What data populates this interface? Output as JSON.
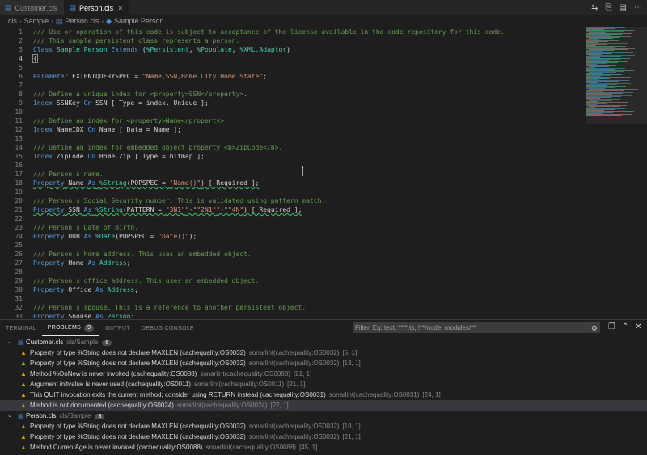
{
  "tabs": [
    {
      "label": "Customer.cls",
      "active": false
    },
    {
      "label": "Person.cls",
      "active": true
    }
  ],
  "tab_close": "×",
  "tab_actions": [
    "⇆",
    "⎘",
    "▤",
    "⋯"
  ],
  "breadcrumb": [
    "cls",
    "Sample",
    "Person.cls",
    "Sample.Person"
  ],
  "code_lines": [
    {
      "n": "1",
      "t": "/// Use or operation of this code is subject to acceptance of the license available in the code repository for this code."
    },
    {
      "n": "2",
      "t": "/// This sample persistent class represents a person."
    },
    {
      "n": "3",
      "t": "Class Sample.Person Extends (%Persistent, %Populate, %XML.Adaptor)"
    },
    {
      "n": "4",
      "t": "{"
    },
    {
      "n": "5",
      "t": ""
    },
    {
      "n": "6",
      "t": "Parameter EXTENTQUERYSPEC = \"Name,SSN,Home.City,Home.State\";"
    },
    {
      "n": "7",
      "t": ""
    },
    {
      "n": "8",
      "t": "/// Define a unique index for <property>SSN</property>."
    },
    {
      "n": "9",
      "t": "Index SSNKey On SSN [ Type = index, Unique ];"
    },
    {
      "n": "10",
      "t": ""
    },
    {
      "n": "11",
      "t": "/// Define an index for <property>Name</property>."
    },
    {
      "n": "12",
      "t": "Index NameIDX On Name [ Data = Name ];"
    },
    {
      "n": "13",
      "t": ""
    },
    {
      "n": "14",
      "t": "/// Define an index for embedded object property <b>ZipCode</b>."
    },
    {
      "n": "15",
      "t": "Index ZipCode On Home.Zip [ Type = bitmap ];"
    },
    {
      "n": "16",
      "t": ""
    },
    {
      "n": "17",
      "t": "/// Person's name."
    },
    {
      "n": "18",
      "t": "Property Name As %String(POPSPEC = \"Name()\") [ Required ];"
    },
    {
      "n": "19",
      "t": ""
    },
    {
      "n": "20",
      "t": "/// Person's Social Security number. This is validated using pattern match."
    },
    {
      "n": "21",
      "t": "Property SSN As %String(PATTERN = \"3N1\"\"-\"\"2N1\"\"-\"\"4N\") [ Required ];"
    },
    {
      "n": "22",
      "t": ""
    },
    {
      "n": "23",
      "t": "/// Person's Date of Birth."
    },
    {
      "n": "24",
      "t": "Property DOB As %Date(POPSPEC = \"Date()\");"
    },
    {
      "n": "25",
      "t": ""
    },
    {
      "n": "26",
      "t": "/// Person's home address. This uses an embedded object."
    },
    {
      "n": "27",
      "t": "Property Home As Address;"
    },
    {
      "n": "28",
      "t": ""
    },
    {
      "n": "29",
      "t": "/// Person's office address. This uses an embedded object."
    },
    {
      "n": "30",
      "t": "Property Office As Address;"
    },
    {
      "n": "31",
      "t": ""
    },
    {
      "n": "32",
      "t": "/// Person's spouse. This is a reference to another persistent object."
    },
    {
      "n": "33",
      "t": "Property Spouse As Person;"
    }
  ],
  "panel": {
    "tabs": [
      "TERMINAL",
      "PROBLEMS",
      "OUTPUT",
      "DEBUG CONSOLE"
    ],
    "problems_count": "9",
    "filter_placeholder": "Filter. Eg: text, **/*.ts, !**/node_modules/**",
    "groups": [
      {
        "file": "Customer.cls",
        "dir": "cls/Sample",
        "count": "6",
        "items": [
          {
            "msg": "Property of type %String does not declare MAXLEN (cachequality:OS0032)",
            "src": "sonarlint(cachequality:OS0032)",
            "pos": "[5, 1]"
          },
          {
            "msg": "Property of type %String does not declare MAXLEN (cachequality:OS0032)",
            "src": "sonarlint(cachequality:OS0032)",
            "pos": "[13, 1]"
          },
          {
            "msg": "Method %OnNew is never invoked (cachequality:OS0088)",
            "src": "sonarlint(cachequality:OS0088)",
            "pos": "[21, 1]"
          },
          {
            "msg": "Argument initvalue is never used (cachequality:OS0011)",
            "src": "sonarlint(cachequality:OS0011)",
            "pos": "[21, 1]"
          },
          {
            "msg": "This QUIT invocation exits the current method; consider using RETURN instead (cachequality:OS0031)",
            "src": "sonarlint(cachequality:OS0031)",
            "pos": "[24, 1]"
          },
          {
            "msg": "Method is not documented (cachequality:OS0024)",
            "src": "sonarlint(cachequality:OS0024)",
            "pos": "[27, 1]"
          }
        ]
      },
      {
        "file": "Person.cls",
        "dir": "cls/Sample",
        "count": "3",
        "items": [
          {
            "msg": "Property of type %String does not declare MAXLEN (cachequality:OS0032)",
            "src": "sonarlint(cachequality:OS0032)",
            "pos": "[18, 1]"
          },
          {
            "msg": "Property of type %String does not declare MAXLEN (cachequality:OS0032)",
            "src": "sonarlint(cachequality:OS0032)",
            "pos": "[21, 1]"
          },
          {
            "msg": "Method CurrentAge is never invoked (cachequality:OS0088)",
            "src": "sonarlint(cachequality:OS0088)",
            "pos": "[45, 1]"
          }
        ]
      }
    ]
  },
  "colors": {
    "comment": "#6a9955",
    "keyword": "#569cd6",
    "class": "#4ec9b0",
    "string": "#ce9178",
    "warning": "#cca700"
  }
}
